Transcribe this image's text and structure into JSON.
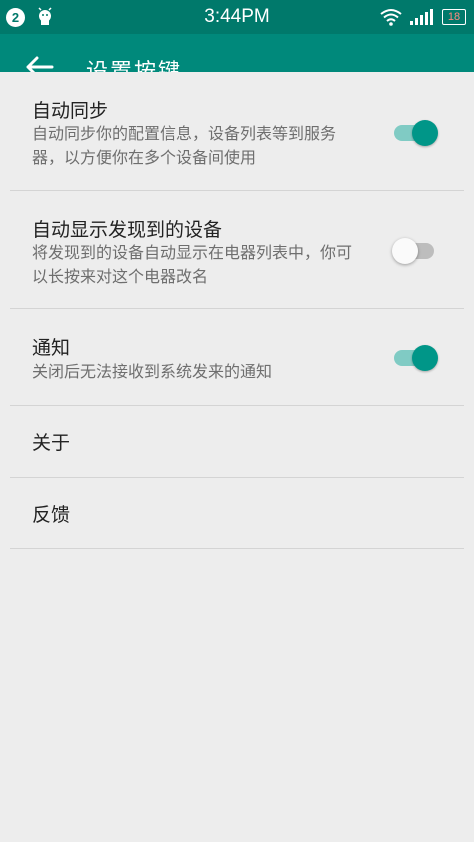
{
  "statusbar": {
    "notification_count": "2",
    "time": "3:44PM",
    "battery": "18"
  },
  "toolbar": {
    "title": "设置按键"
  },
  "settings": [
    {
      "title": "自动同步",
      "subtitle": "自动同步你的配置信息，设备列表等到服务器，以方便你在多个设备间使用",
      "toggle": "on"
    },
    {
      "title": "自动显示发现到的设备",
      "subtitle": "将发现到的设备自动显示在电器列表中，你可以长按来对这个电器改名",
      "toggle": "off"
    },
    {
      "title": "通知",
      "subtitle": "关闭后无法接收到系统发来的通知",
      "toggle": "on"
    },
    {
      "title": "关于"
    },
    {
      "title": "反馈"
    }
  ],
  "colors": {
    "primary_dark": "#00796b",
    "primary": "#00897b",
    "accent": "#009688"
  },
  "icons": [
    "notification-badge-icon",
    "android-icon",
    "wifi-icon",
    "signal-icon",
    "battery-icon",
    "back-arrow-icon"
  ]
}
